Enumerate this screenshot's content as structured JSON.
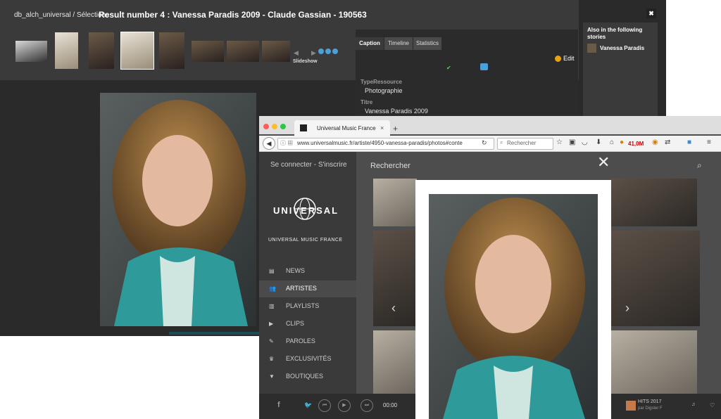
{
  "db_window": {
    "breadcrumb": "db_alch_universal / Sélections",
    "title": "Result number 4 : Vanessa Paradis 2009 - Claude Gassian - 190563",
    "close_label": "✖",
    "slideshow_label": "Slideshow",
    "tabs": [
      "Caption",
      "Timeline",
      "Statistics"
    ],
    "edit_label": "Edit",
    "fields": [
      {
        "label": "TypeRessource",
        "value": "Photographie"
      },
      {
        "label": "Titre",
        "value": "Vanessa Paradis 2009"
      }
    ],
    "also_title": "Also in the following stories",
    "also_item": "Vanessa Paradis"
  },
  "browser": {
    "tab_title": "Universal Music France",
    "tab_close": "×",
    "new_tab": "+",
    "url": "www.universalmusic.fr/artiste/4950-vanessa-paradis/photos#conte",
    "search_placeholder": "Rechercher",
    "badge": "41,0M"
  },
  "site": {
    "login": "Se connecter - S'inscrire",
    "logo": "UNIVERSAL",
    "brand": "UNIVERSAL MUSIC FRANCE",
    "search_label": "Rechercher",
    "menu": [
      {
        "label": "NEWS",
        "icon": "news-icon"
      },
      {
        "label": "ARTISTES",
        "icon": "artists-icon"
      },
      {
        "label": "PLAYLISTS",
        "icon": "playlists-icon"
      },
      {
        "label": "CLIPS",
        "icon": "clips-icon"
      },
      {
        "label": "PAROLES",
        "icon": "lyrics-icon"
      },
      {
        "label": "EXCLUSIVITÉS",
        "icon": "crown-icon"
      },
      {
        "label": "BOUTIQUES",
        "icon": "shirt-icon"
      }
    ],
    "player": {
      "time": "00:00",
      "hits_title": "HITS 2017",
      "hits_by": "par Digster F"
    }
  }
}
